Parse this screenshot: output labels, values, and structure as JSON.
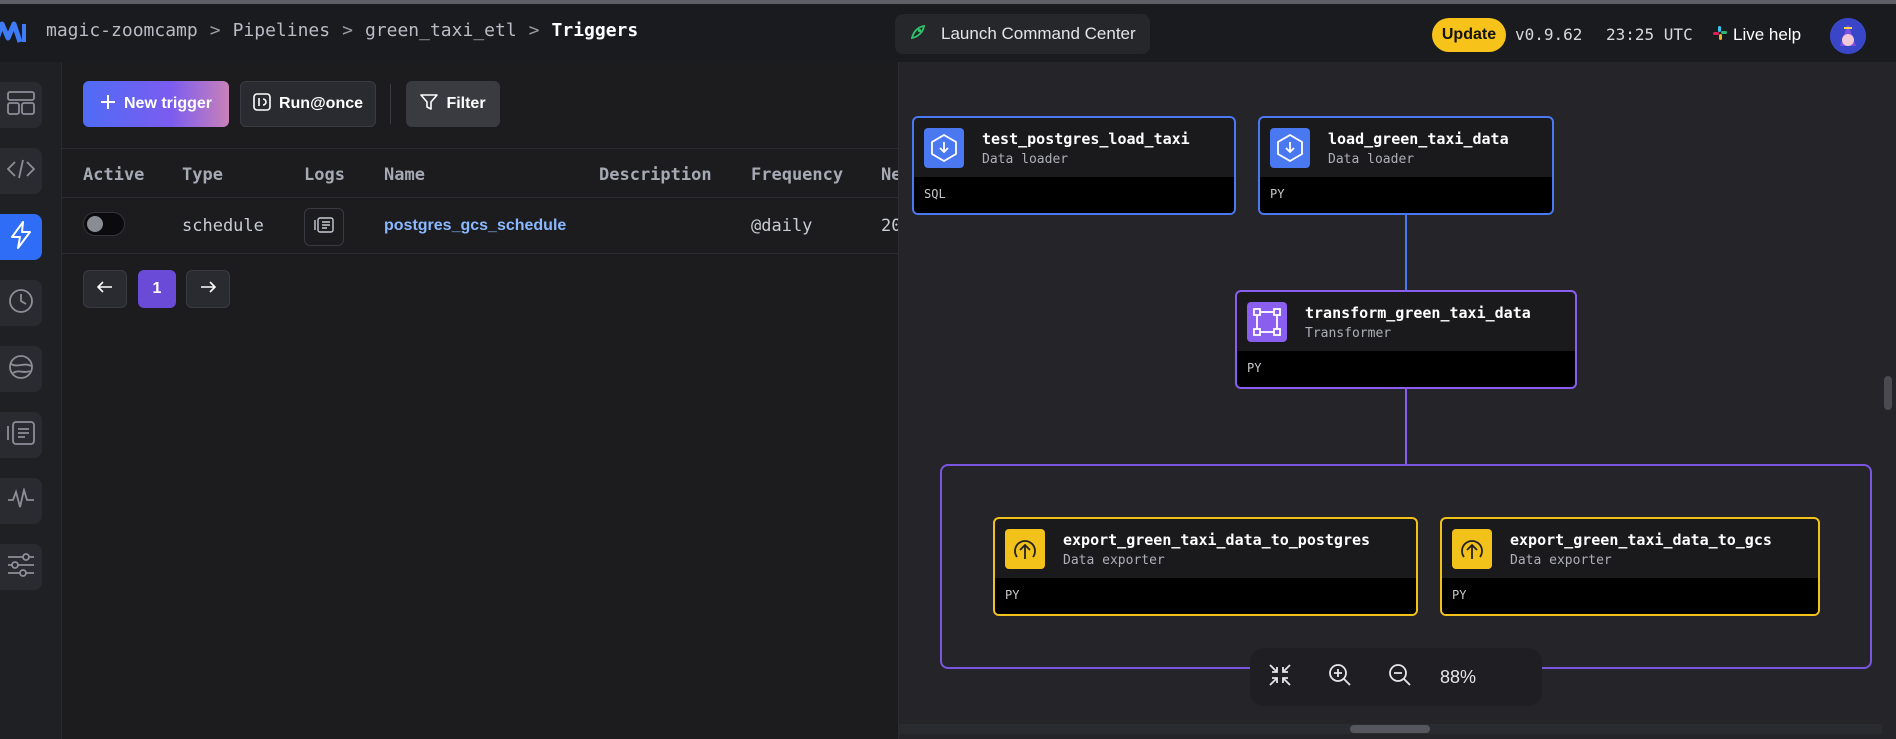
{
  "breadcrumbs": {
    "project": "magic-zoomcamp",
    "section": "Pipelines",
    "pipeline": "green_taxi_etl",
    "current": "Triggers",
    "separator": ">"
  },
  "header": {
    "launch_label": "Launch Command Center",
    "update_label": "Update",
    "version": "v0.9.62",
    "time": "23:25 UTC",
    "live_help": "Live help"
  },
  "toolbar": {
    "new_trigger": "New trigger",
    "run_once": "Run@once",
    "filter": "Filter"
  },
  "table": {
    "columns": [
      "Active",
      "Type",
      "Logs",
      "Name",
      "Description",
      "Frequency",
      "Ne"
    ],
    "rows": [
      {
        "active": false,
        "type": "schedule",
        "name": "postgres_gcs_schedule",
        "description": "",
        "frequency": "@daily",
        "next": "20"
      }
    ]
  },
  "pagination": {
    "current_page": "1"
  },
  "graph": {
    "zoom": "88%",
    "nodes": [
      {
        "id": "test_postgres_load_taxi",
        "name": "test_postgres_load_taxi",
        "type": "Data loader",
        "lang": "SQL",
        "color": "#4a78f0"
      },
      {
        "id": "load_green_taxi_data",
        "name": "load_green_taxi_data",
        "type": "Data loader",
        "lang": "PY",
        "color": "#4a78f0"
      },
      {
        "id": "transform_green_taxi_data",
        "name": "transform_green_taxi_data",
        "type": "Transformer",
        "lang": "PY",
        "color": "#8a5ff0"
      },
      {
        "id": "export_green_taxi_data_to_postgres",
        "name": "export_green_taxi_data_to_postgres",
        "type": "Data exporter",
        "lang": "PY",
        "color": "#f2c21b"
      },
      {
        "id": "export_green_taxi_data_to_gcs",
        "name": "export_green_taxi_data_to_gcs",
        "type": "Data exporter",
        "lang": "PY",
        "color": "#f2c21b"
      }
    ]
  },
  "sidebar": {
    "icons": [
      "layout-icon",
      "code-icon",
      "lightning-icon",
      "clock-icon",
      "globe-icon",
      "logs-icon",
      "pulse-icon",
      "settings-sliders-icon"
    ],
    "active": "lightning-icon"
  },
  "colors": {
    "accent": "#2f6df6",
    "loader": "#4a78f0",
    "transformer": "#8a5ff0",
    "exporter": "#f2c21b",
    "update": "#f7c31b"
  }
}
